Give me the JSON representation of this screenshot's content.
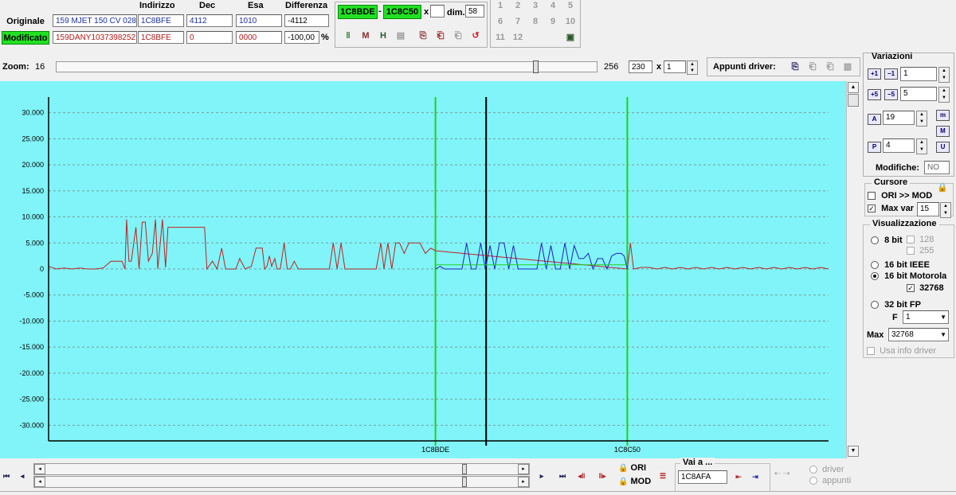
{
  "header": {
    "col_indirizzo": "Indirizzo",
    "col_dec": "Dec",
    "col_esa": "Esa",
    "col_differenza": "Differenza",
    "originale_btn": "Originale",
    "modificato_btn": "Modificato",
    "ori_file": "159 MJET 150 CV 028",
    "mod_file": "159DANY1037398252",
    "ori_indirizzo": "1C8BFE",
    "mod_indirizzo": "1C8BFE",
    "ori_dec": "4112",
    "mod_dec": "0",
    "ori_esa": "1010",
    "mod_esa": "0000",
    "ori_diff": "-4112",
    "mod_diff": "-100,00",
    "percent": "%"
  },
  "range": {
    "start": "1C8BDE",
    "sep": "-",
    "end": "1C8C50",
    "x": "x",
    "dim_label": "dim.",
    "dim_value": "58"
  },
  "numpad": [
    "1",
    "2",
    "3",
    "4",
    "5",
    "6",
    "7",
    "8",
    "9",
    "10",
    "11",
    "12"
  ],
  "zoom": {
    "label": "Zoom:",
    "min": "16",
    "max": "256",
    "value": "230",
    "x": "x",
    "mult": "1",
    "slider_fraction": 0.89
  },
  "appunti": {
    "label": "Appunti driver:"
  },
  "variazioni": {
    "title": "Variazioni",
    "v1": "1",
    "v2": "5",
    "a": "19",
    "p": "4",
    "modifiche_label": "Modifiche:",
    "modifiche_value": "NO",
    "btn_m": "m",
    "btn_M": "M",
    "btn_U": "U",
    "btn_A": "A",
    "btn_P": "P"
  },
  "cursore": {
    "title": "Cursore",
    "ori_mod": "ORI >> MOD",
    "ori_mod_checked": false,
    "maxvar_label": "Max var",
    "maxvar_checked": true,
    "maxvar_value": "15"
  },
  "visualizzazione": {
    "title": "Visualizzazione",
    "opt_8bit": "8 bit",
    "opt_128": "128",
    "opt_255": "255",
    "opt_ieee": "16 bit IEEE",
    "opt_motorola": "16 bit Motorola",
    "opt_32768": "32768",
    "opt_32fp": "32 bit FP",
    "f_label": "F",
    "f_value": "1",
    "max_label": "Max",
    "max_value": "32768",
    "usa_info": "Usa info driver",
    "selected": "16 bit Motorola"
  },
  "bottom": {
    "ori": "ORI",
    "mod": "MOD",
    "vai_label": "Vai a ...",
    "vai_value": "1C8AFA",
    "driver": "driver",
    "appunti": "appunti"
  },
  "chart_data": {
    "type": "line",
    "ylim": [
      -33000,
      33000
    ],
    "yticks": [
      30000,
      25000,
      20000,
      15000,
      10000,
      5000,
      0,
      -5000,
      -10000,
      -15000,
      -20000,
      -25000,
      -30000
    ],
    "ytick_labels": [
      "30.000",
      "25.000",
      "20.000",
      "15.000",
      "10.000",
      "5.000",
      "0",
      "-5.000",
      "-10.000",
      "-15.000",
      "-20.000",
      "-25.000",
      "-30.000"
    ],
    "xlim": [
      0,
      100
    ],
    "grid": true,
    "background": "#80f4f8",
    "markers": [
      {
        "label": "1C8BDE",
        "x": 49.6,
        "color": "#20d020"
      },
      {
        "label": "",
        "x": 56.1,
        "color": "#000000"
      },
      {
        "label": "1C8C50",
        "x": 74.2,
        "color": "#20d020"
      }
    ],
    "colors": {
      "original": "#2020c0",
      "modified": "#c02020",
      "baseline": "#20d020"
    },
    "series_original_range_x": [
      49.6,
      74.2
    ],
    "series": [
      {
        "role": "modified",
        "points": [
          [
            0,
            500
          ],
          [
            1,
            0
          ],
          [
            2,
            200
          ],
          [
            3,
            0
          ],
          [
            4,
            200
          ],
          [
            5,
            0
          ],
          [
            6,
            0
          ],
          [
            7,
            200
          ],
          [
            8,
            1500
          ],
          [
            9,
            1500
          ],
          [
            9.4,
            1500
          ],
          [
            9.8,
            0
          ],
          [
            10,
            9500
          ],
          [
            10.3,
            1500
          ],
          [
            10.6,
            1500
          ],
          [
            11.2,
            8000
          ],
          [
            11.6,
            0
          ],
          [
            12,
            9000
          ],
          [
            12.4,
            9000
          ],
          [
            12.8,
            1500
          ],
          [
            13.3,
            3000
          ],
          [
            13.7,
            9500
          ],
          [
            14,
            0
          ],
          [
            14.6,
            9500
          ],
          [
            15,
            300
          ],
          [
            15.3,
            8000
          ],
          [
            16,
            8000
          ],
          [
            17,
            8000
          ],
          [
            18,
            8000
          ],
          [
            19,
            8000
          ],
          [
            20,
            8000
          ],
          [
            20.3,
            0
          ],
          [
            21,
            1500
          ],
          [
            21.6,
            0
          ],
          [
            22.2,
            4000
          ],
          [
            22.7,
            0
          ],
          [
            23.5,
            0
          ],
          [
            24,
            0
          ],
          [
            24.5,
            2000
          ],
          [
            25.2,
            0
          ],
          [
            26,
            500
          ],
          [
            26.6,
            4000
          ],
          [
            27,
            4000
          ],
          [
            27.4,
            4000
          ],
          [
            27.7,
            0
          ],
          [
            28,
            500
          ],
          [
            28.3,
            2500
          ],
          [
            28.6,
            500
          ],
          [
            29,
            2000
          ],
          [
            29.3,
            0
          ],
          [
            29.7,
            0
          ],
          [
            30.2,
            5000
          ],
          [
            30.6,
            0
          ],
          [
            31,
            0
          ],
          [
            31.5,
            1500
          ],
          [
            32,
            0
          ],
          [
            33,
            0
          ],
          [
            34,
            0
          ],
          [
            35,
            0
          ],
          [
            36,
            0
          ],
          [
            36.5,
            5000
          ],
          [
            37,
            0
          ],
          [
            37.5,
            5000
          ],
          [
            38,
            0
          ],
          [
            39,
            0
          ],
          [
            40,
            0
          ],
          [
            41,
            0
          ],
          [
            42,
            0
          ],
          [
            42.6,
            5000
          ],
          [
            43,
            0
          ],
          [
            43.5,
            5000
          ],
          [
            44,
            0
          ],
          [
            44.5,
            5000
          ],
          [
            45,
            5000
          ],
          [
            45.6,
            3000
          ],
          [
            46.2,
            5000
          ],
          [
            47,
            5000
          ],
          [
            47.6,
            5000
          ],
          [
            48.3,
            3000
          ],
          [
            49,
            4000
          ],
          [
            49.6,
            3500
          ],
          [
            74.2,
            0
          ],
          [
            74.6,
            5000
          ],
          [
            75,
            0
          ],
          [
            76,
            300
          ],
          [
            77,
            300
          ],
          [
            78,
            0
          ],
          [
            79,
            300
          ],
          [
            80,
            0
          ],
          [
            81,
            300
          ],
          [
            82,
            0
          ],
          [
            83,
            300
          ],
          [
            84,
            0
          ],
          [
            85,
            300
          ],
          [
            86,
            0
          ],
          [
            87,
            300
          ],
          [
            88,
            0
          ],
          [
            89,
            300
          ],
          [
            90,
            0
          ],
          [
            91,
            300
          ],
          [
            92,
            0
          ],
          [
            93,
            300
          ],
          [
            94,
            0
          ],
          [
            95,
            300
          ],
          [
            96,
            0
          ],
          [
            97,
            300
          ],
          [
            98,
            0
          ],
          [
            99,
            300
          ],
          [
            100,
            0
          ]
        ]
      },
      {
        "role": "original",
        "points": [
          [
            49.6,
            0
          ],
          [
            50.2,
            500
          ],
          [
            50.8,
            0
          ],
          [
            53,
            0
          ],
          [
            53.6,
            5000
          ],
          [
            54.2,
            0
          ],
          [
            54.8,
            0
          ],
          [
            55.4,
            5000
          ],
          [
            56,
            0
          ],
          [
            56.6,
            4500
          ],
          [
            57.2,
            0
          ],
          [
            57.8,
            5000
          ],
          [
            58.4,
            5000
          ],
          [
            59,
            0
          ],
          [
            59.6,
            4500
          ],
          [
            60.2,
            0
          ],
          [
            61,
            0
          ],
          [
            62.6,
            0
          ],
          [
            63.2,
            5000
          ],
          [
            63.8,
            0
          ],
          [
            64.4,
            4500
          ],
          [
            65,
            0
          ],
          [
            65.6,
            0
          ],
          [
            66.2,
            5000
          ],
          [
            66.8,
            0
          ],
          [
            67.4,
            4500
          ],
          [
            68,
            2000
          ],
          [
            68.6,
            2000
          ],
          [
            69.2,
            3000
          ],
          [
            69.8,
            0
          ],
          [
            70.4,
            2000
          ],
          [
            71,
            2000
          ],
          [
            71.6,
            0
          ],
          [
            72.2,
            2500
          ],
          [
            72.8,
            3000
          ],
          [
            73.4,
            3000
          ],
          [
            73.8,
            2500
          ],
          [
            74.2,
            0
          ]
        ]
      },
      {
        "role": "baseline",
        "points": [
          [
            49.6,
            800
          ],
          [
            74.2,
            800
          ]
        ]
      }
    ]
  }
}
